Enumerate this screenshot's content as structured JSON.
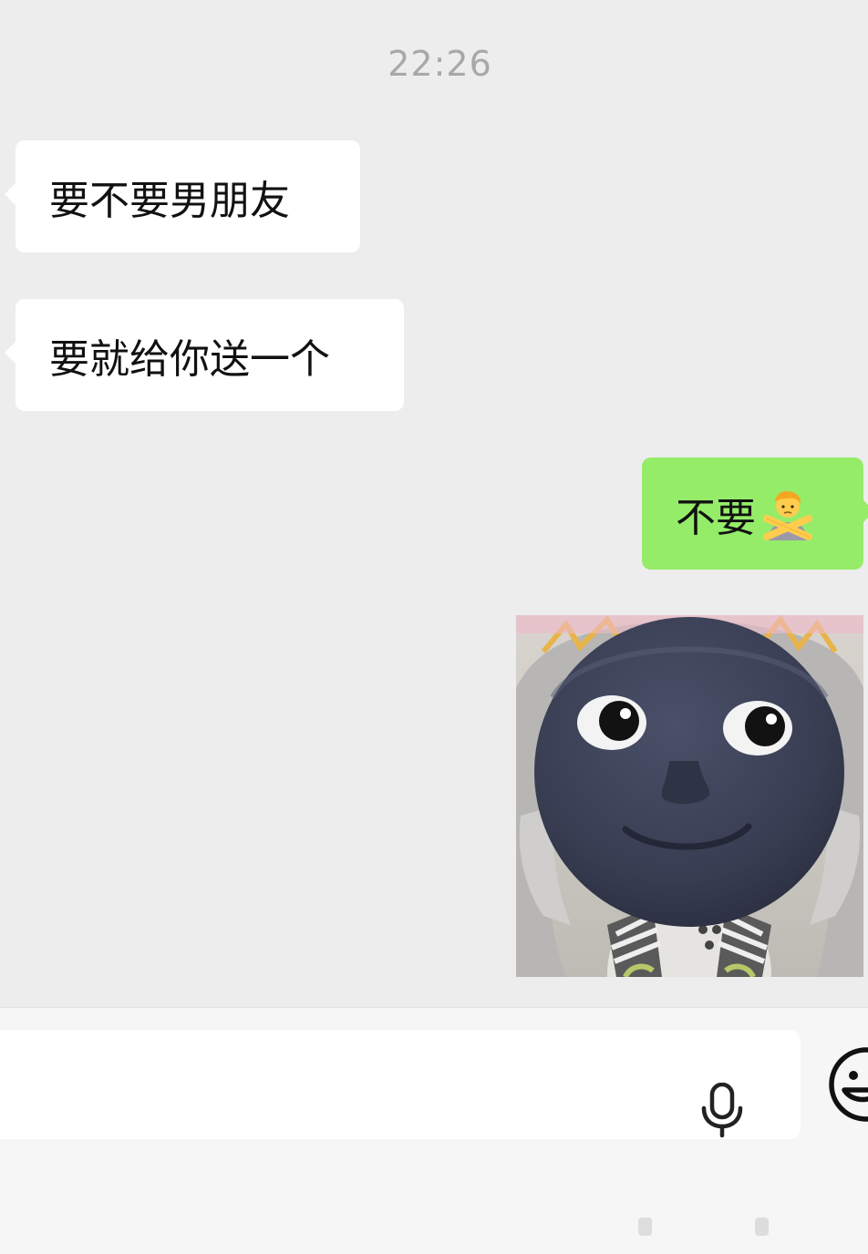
{
  "chat": {
    "timestamp": "22:26",
    "messages": [
      {
        "direction": "incoming",
        "text": "要不要男朋友"
      },
      {
        "direction": "incoming",
        "text": "要就给你送一个"
      },
      {
        "direction": "outgoing",
        "text": "不要",
        "emoji": "person-gesturing-no-emoji"
      },
      {
        "direction": "outgoing",
        "type": "sticker",
        "sticker": "dark-moon-face-sticker"
      }
    ]
  },
  "input_bar": {
    "placeholder": "",
    "icons": [
      "microphone-icon",
      "smiley-face-icon"
    ]
  },
  "colors": {
    "background": "#ededed",
    "incoming_bubble": "#ffffff",
    "outgoing_bubble": "#95ec69",
    "timestamp": "#a8a8a8"
  }
}
